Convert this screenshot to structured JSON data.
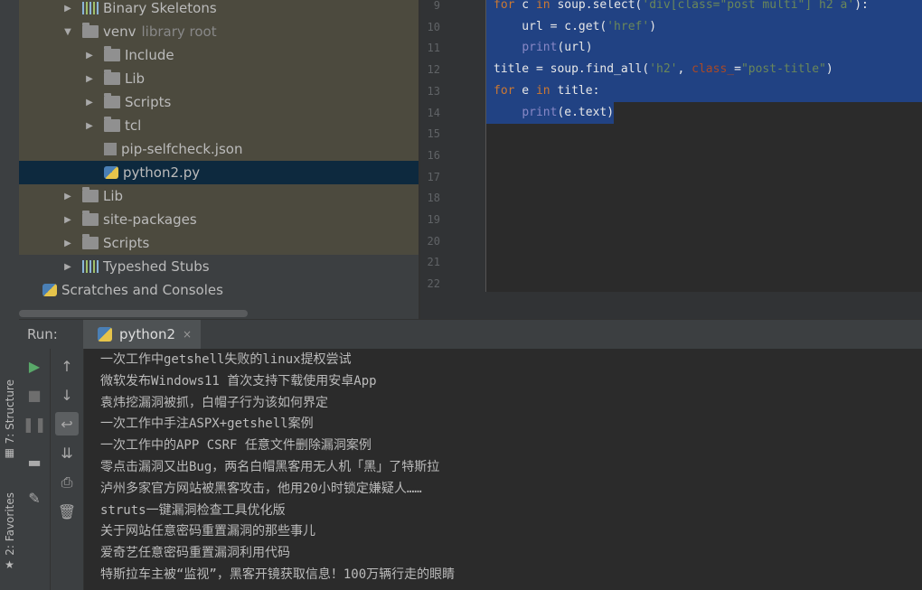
{
  "sidebar": {
    "structure_label": "7: Structure",
    "favorites_label": "2: Favorites"
  },
  "project_tree": [
    {
      "label": "Binary Skeletons",
      "type": "library",
      "arrow": "right",
      "indent": 1,
      "style": "excluded"
    },
    {
      "label": "venv",
      "suffix": "library root",
      "type": "folder",
      "arrow": "down",
      "indent": 1,
      "style": "excluded"
    },
    {
      "label": "Include",
      "type": "folder",
      "arrow": "right",
      "indent": 2,
      "style": "excluded"
    },
    {
      "label": "Lib",
      "type": "folder",
      "arrow": "right",
      "indent": 2,
      "style": "excluded"
    },
    {
      "label": "Scripts",
      "type": "folder",
      "arrow": "right",
      "indent": 2,
      "style": "excluded"
    },
    {
      "label": "tcl",
      "type": "folder",
      "arrow": "right",
      "indent": 2,
      "style": "excluded"
    },
    {
      "label": "pip-selfcheck.json",
      "type": "file",
      "arrow": "none",
      "indent": 2,
      "style": "excluded"
    },
    {
      "label": "python2.py",
      "type": "python",
      "arrow": "none",
      "indent": 2,
      "style": "selected"
    },
    {
      "label": "Lib",
      "type": "folder",
      "arrow": "right",
      "indent": 1,
      "style": "excluded"
    },
    {
      "label": "site-packages",
      "type": "folder",
      "arrow": "right",
      "indent": 1,
      "style": "excluded"
    },
    {
      "label": "Scripts",
      "type": "folder",
      "arrow": "right",
      "indent": 1,
      "style": "excluded"
    },
    {
      "label": "Typeshed Stubs",
      "type": "library",
      "arrow": "right",
      "indent": 1,
      "style": "normal"
    },
    {
      "label": "Scratches and Consoles",
      "type": "scratch",
      "arrow": "none",
      "indent": 0,
      "style": "normal"
    }
  ],
  "editor": {
    "line_numbers": [
      "9",
      "10",
      "11",
      "12",
      "13",
      "14",
      "15",
      "16",
      "17",
      "18",
      "19",
      "20",
      "21",
      "22"
    ],
    "code_lines": [
      {
        "selected": true,
        "tokens": [
          {
            "t": "for",
            "c": "kw"
          },
          {
            "t": " c ",
            "c": ""
          },
          {
            "t": "in",
            "c": "kw"
          },
          {
            "t": " soup.select(",
            "c": ""
          },
          {
            "t": "'div[class=\"post multi\"] h2 a'",
            "c": "str"
          },
          {
            "t": "):",
            "c": ""
          }
        ]
      },
      {
        "selected": true,
        "tokens": [
          {
            "t": "    url = c.get(",
            "c": ""
          },
          {
            "t": "'href'",
            "c": "str"
          },
          {
            "t": ")",
            "c": ""
          }
        ]
      },
      {
        "selected": true,
        "tokens": [
          {
            "t": "    ",
            "c": ""
          },
          {
            "t": "print",
            "c": "fn"
          },
          {
            "t": "(url)",
            "c": ""
          }
        ]
      },
      {
        "selected": true,
        "tokens": [
          {
            "t": "title = soup.find_all(",
            "c": ""
          },
          {
            "t": "'h2'",
            "c": "str"
          },
          {
            "t": ", ",
            "c": ""
          },
          {
            "t": "class_",
            "c": "kwarg"
          },
          {
            "t": "=",
            "c": ""
          },
          {
            "t": "\"post-title\"",
            "c": "str"
          },
          {
            "t": ")",
            "c": ""
          }
        ]
      },
      {
        "selected": true,
        "tokens": [
          {
            "t": "for",
            "c": "kw"
          },
          {
            "t": " e ",
            "c": ""
          },
          {
            "t": "in",
            "c": "kw"
          },
          {
            "t": " title:",
            "c": ""
          }
        ]
      },
      {
        "selected": "partial",
        "tokens": [
          {
            "t": "    ",
            "c": ""
          },
          {
            "t": "print",
            "c": "fn"
          },
          {
            "t": "(e.text)",
            "c": ""
          }
        ]
      }
    ]
  },
  "run_panel": {
    "run_label": "Run:",
    "tab_label": "python2",
    "close_glyph": "×",
    "output_lines": [
      "一次工作中getshell失败的linux提权尝试",
      "微软发布Windows11 首次支持下载使用安卓App",
      "袁炜挖漏洞被抓，白帽子行为该如何界定",
      "一次工作中手注ASPX+getshell案例",
      "一次工作中的APP CSRF 任意文件删除漏洞案例",
      "零点击漏洞又出Bug，两名白帽黑客用无人机「黑」了特斯拉",
      "泸州多家官方网站被黑客攻击，他用20小时锁定嫌疑人……",
      "struts一键漏洞检查工具优化版",
      "关于网站任意密码重置漏洞的那些事儿",
      "爱奇艺任意密码重置漏洞利用代码",
      "特斯拉车主被“监视”，黑客开镜获取信息！100万辆行走的眼睛"
    ]
  },
  "colors": {
    "selection": "#214283",
    "tree_selected": "#0d293e",
    "excluded_bg": "#4c4a3e",
    "run_green": "#59a869"
  }
}
